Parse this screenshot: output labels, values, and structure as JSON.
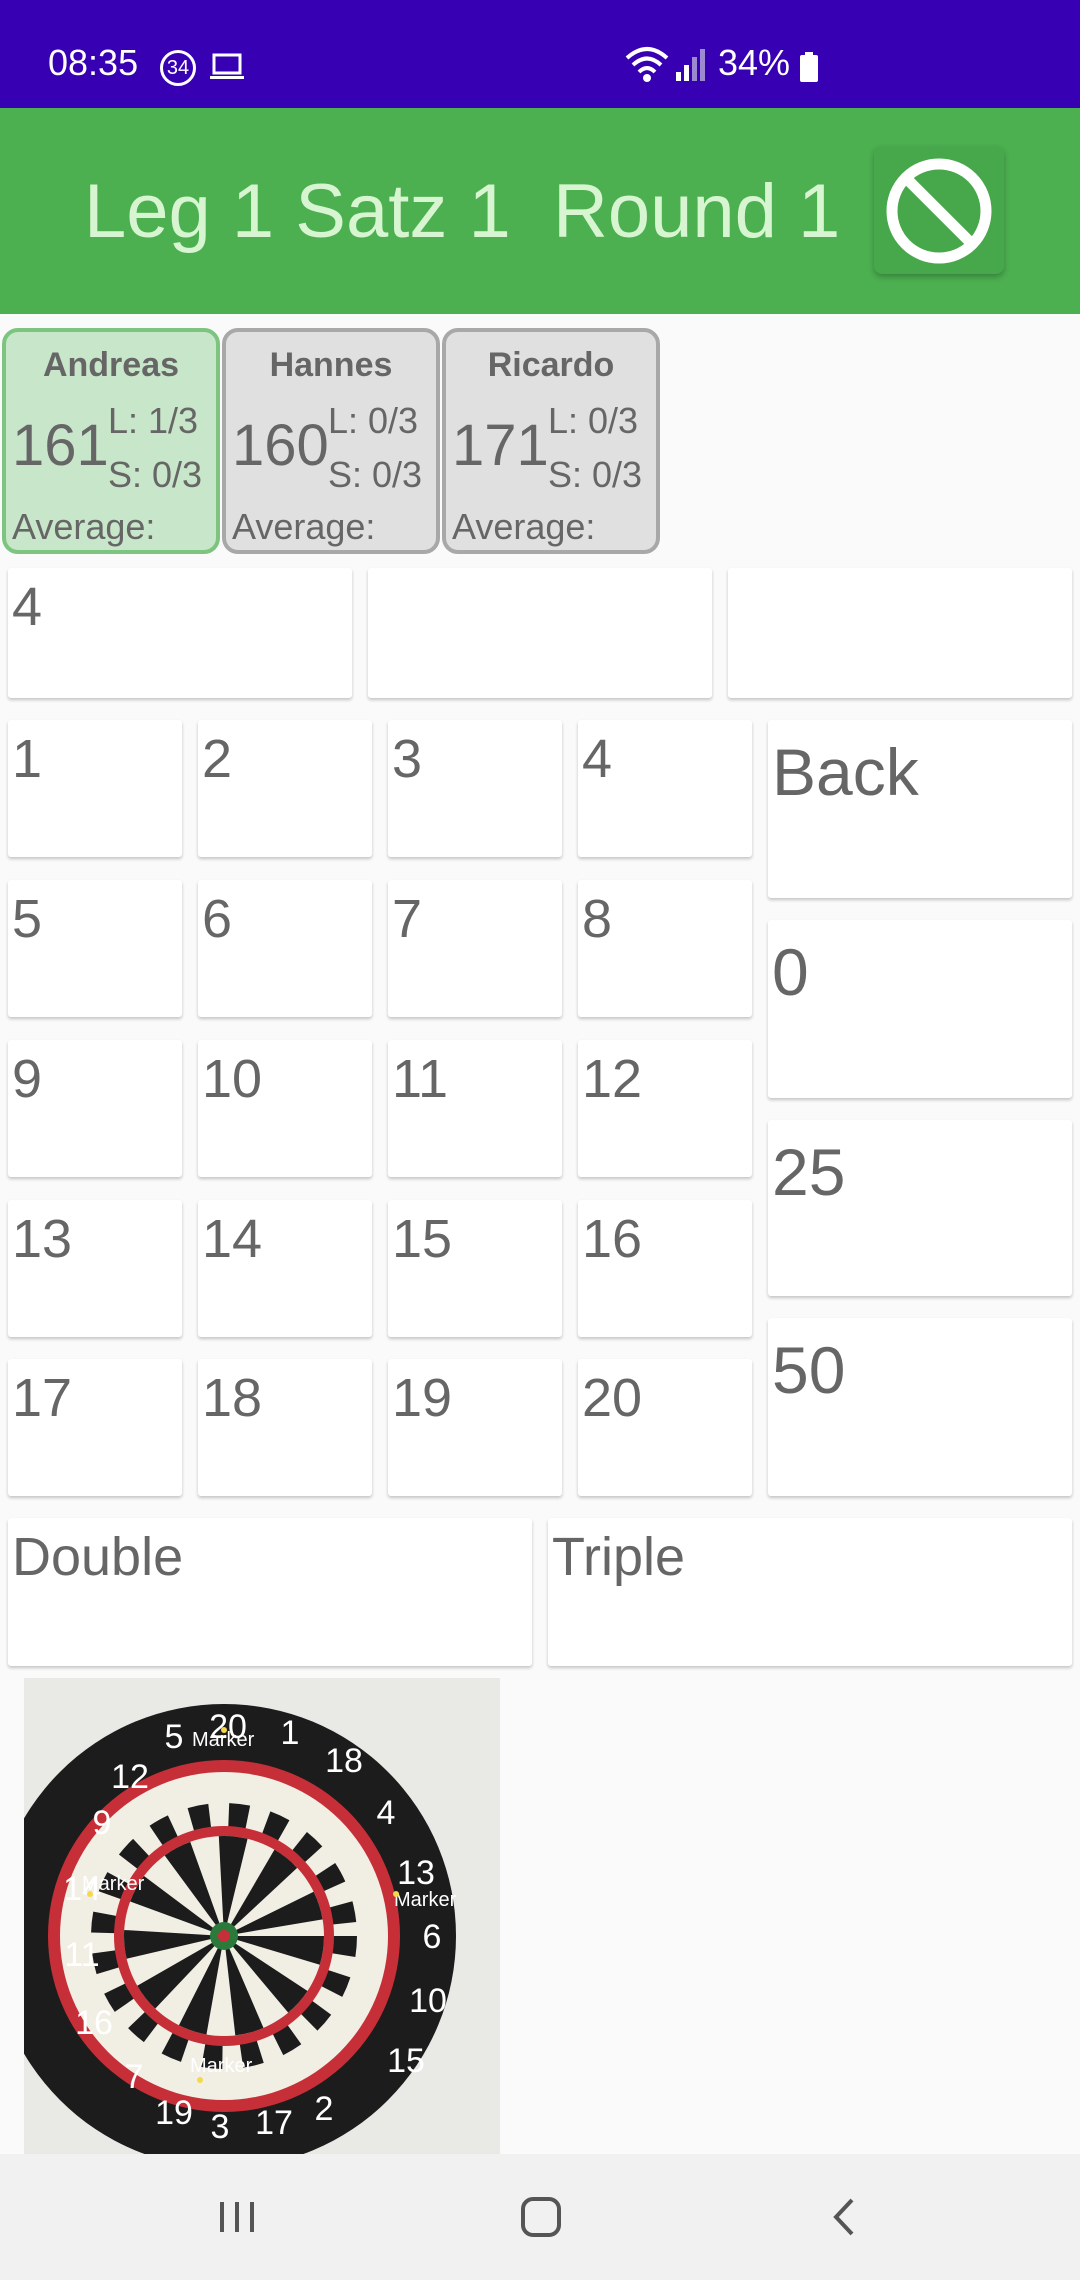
{
  "status_bar": {
    "time": "08:35",
    "notification_badge": "34",
    "battery_percent": "34%"
  },
  "app_bar": {
    "title": "Leg 1 Satz 1  Round 1",
    "cancel_icon": "cancel-icon"
  },
  "players": [
    {
      "name": "Andreas",
      "score": "161",
      "legs": "L: 1/3",
      "sets": "S: 0/3",
      "average_label": "Average:",
      "active": true
    },
    {
      "name": "Hannes",
      "score": "160",
      "legs": "L: 0/3",
      "sets": "S: 0/3",
      "average_label": "Average:",
      "active": false
    },
    {
      "name": "Ricardo",
      "score": "171",
      "legs": "L: 0/3",
      "sets": "S: 0/3",
      "average_label": "Average:",
      "active": false
    }
  ],
  "throws": [
    "4",
    "",
    ""
  ],
  "keypad": {
    "numbers": [
      "1",
      "2",
      "3",
      "4",
      "5",
      "6",
      "7",
      "8",
      "9",
      "10",
      "11",
      "12",
      "13",
      "14",
      "15",
      "16",
      "17",
      "18",
      "19",
      "20"
    ],
    "back": "Back",
    "zero": "0",
    "bull": "25",
    "bullseye": "50",
    "double": "Double",
    "triple": "Triple"
  },
  "dartboard": {
    "markers": [
      "Marker",
      "Marker",
      "Marker",
      "Marker"
    ]
  },
  "colors": {
    "status_bar": "#3700b3",
    "app_bar": "#4caf50",
    "active_card": "#c8e6c9"
  }
}
